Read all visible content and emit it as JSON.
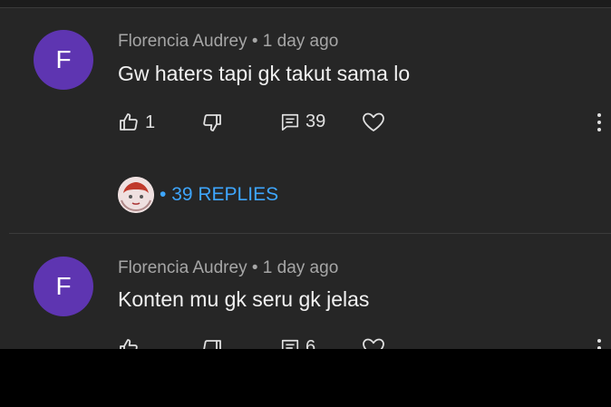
{
  "comments": [
    {
      "avatar_letter": "F",
      "avatar_color": "#5e35b1",
      "author": "Florencia Audrey",
      "separator": "•",
      "time": "1 day ago",
      "text": "Gw haters tapi gk takut sama lo",
      "likes": "1",
      "replies_count": "39",
      "replies_link": "39 REPLIES"
    },
    {
      "avatar_letter": "F",
      "avatar_color": "#5e35b1",
      "author": "Florencia Audrey",
      "separator": "•",
      "time": "1 day ago",
      "text": "Konten mu gk seru gk jelas",
      "replies_count": "6"
    }
  ],
  "icons": [
    "like-icon",
    "dislike-icon",
    "reply-icon",
    "heart-icon",
    "more-vert-icon"
  ],
  "colors": {
    "background": "#262626",
    "link": "#3ea6ff",
    "avatar": "#5e35b1"
  }
}
